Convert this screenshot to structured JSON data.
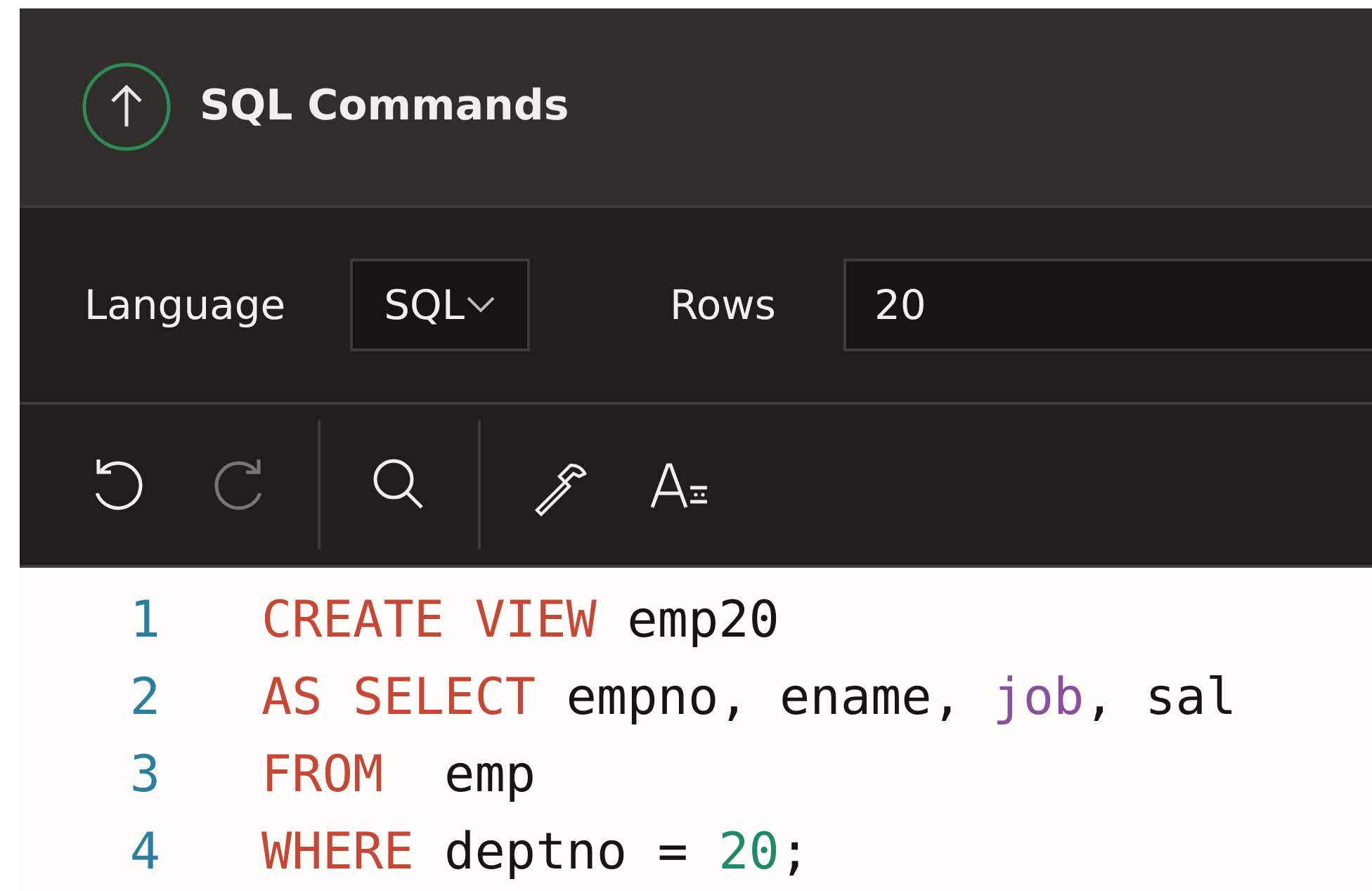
{
  "header": {
    "title": "SQL Commands"
  },
  "toolbar": {
    "language_label": "Language",
    "language_value": "SQL",
    "rows_label": "Rows",
    "rows_value": "20"
  },
  "editor_toolbar": [
    {
      "kind": "undo",
      "disabled": false
    },
    {
      "kind": "redo",
      "disabled": true
    },
    {
      "kind": "divider"
    },
    {
      "kind": "search",
      "disabled": false
    },
    {
      "kind": "divider"
    },
    {
      "kind": "hammer",
      "disabled": false
    },
    {
      "kind": "font",
      "disabled": false
    }
  ],
  "editor": {
    "lines": [
      {
        "number": "1",
        "tokens": [
          {
            "kind": "keyword",
            "text": "CREATE VIEW"
          },
          {
            "kind": "plain",
            "text": " emp20"
          }
        ]
      },
      {
        "number": "2",
        "tokens": [
          {
            "kind": "keyword",
            "text": "AS SELECT"
          },
          {
            "kind": "plain",
            "text": " empno, ename, "
          },
          {
            "kind": "function",
            "text": "job"
          },
          {
            "kind": "plain",
            "text": ", sal"
          }
        ]
      },
      {
        "number": "3",
        "tokens": [
          {
            "kind": "keyword",
            "text": "FROM"
          },
          {
            "kind": "plain",
            "text": "  emp"
          }
        ]
      },
      {
        "number": "4",
        "tokens": [
          {
            "kind": "keyword",
            "text": "WHERE"
          },
          {
            "kind": "plain",
            "text": " deptno = "
          },
          {
            "kind": "number",
            "text": "20"
          },
          {
            "kind": "plain",
            "text": ";"
          }
        ]
      }
    ]
  }
}
